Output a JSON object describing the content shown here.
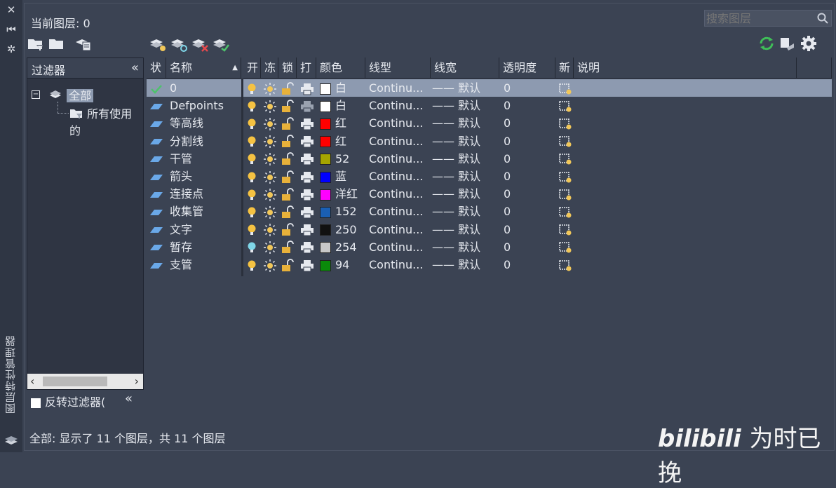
{
  "palette": {
    "list_bg": "#3b4353",
    "selection": "#8d9ab0",
    "bulb_on": "#f5c242",
    "bulb_off": "#7fd6e8",
    "sun": "#f1c75a",
    "lock": "#e8b13a",
    "check": "#4ec26c",
    "layer_icon": "#6aa8e8",
    "refresh": "#3fbf58"
  },
  "panel": {
    "current_layer": "当前图层: 0",
    "search_placeholder": "搜索图层",
    "status": "全部: 显示了 11 个图层，共 11 个图层",
    "vertical_title": "图层特性管理器"
  },
  "filters": {
    "header": "过滤器",
    "tree_all": "全部",
    "tree_used": "所有使用的",
    "invert_label": "反转过滤器("
  },
  "columns": {
    "status": "状",
    "name": "名称",
    "on": "开",
    "freeze": "冻",
    "lock": "锁",
    "plot": "打",
    "color": "颜色",
    "linetype": "线型",
    "lineweight": "线宽",
    "transparency": "透明度",
    "new_vp": "新",
    "description": "说明"
  },
  "layers": [
    {
      "name": "0",
      "current": true,
      "on": true,
      "plot": true,
      "color_hex": "#ffffff",
      "color": "白",
      "linetype": "Continu...",
      "lineweight": "—— 默认",
      "transparency": "0"
    },
    {
      "name": "Defpoints",
      "current": false,
      "on": true,
      "plot": false,
      "color_hex": "#ffffff",
      "color": "白",
      "linetype": "Continu...",
      "lineweight": "—— 默认",
      "transparency": "0"
    },
    {
      "name": "等高线",
      "current": false,
      "on": true,
      "plot": true,
      "color_hex": "#ff0000",
      "color": "红",
      "linetype": "Continu...",
      "lineweight": "—— 默认",
      "transparency": "0"
    },
    {
      "name": "分割线",
      "current": false,
      "on": true,
      "plot": true,
      "color_hex": "#ff0000",
      "color": "红",
      "linetype": "Continu...",
      "lineweight": "—— 默认",
      "transparency": "0"
    },
    {
      "name": "干管",
      "current": false,
      "on": true,
      "plot": true,
      "color_hex": "#a5a500",
      "color": "52",
      "linetype": "Continu...",
      "lineweight": "—— 默认",
      "transparency": "0"
    },
    {
      "name": "箭头",
      "current": false,
      "on": true,
      "plot": true,
      "color_hex": "#0000ff",
      "color": "蓝",
      "linetype": "Continu...",
      "lineweight": "—— 默认",
      "transparency": "0"
    },
    {
      "name": "连接点",
      "current": false,
      "on": true,
      "plot": true,
      "color_hex": "#ff00ff",
      "color": "洋红",
      "linetype": "Continu...",
      "lineweight": "—— 默认",
      "transparency": "0"
    },
    {
      "name": "收集管",
      "current": false,
      "on": true,
      "plot": true,
      "color_hex": "#1a5fb4",
      "color": "152",
      "linetype": "Continu...",
      "lineweight": "—— 默认",
      "transparency": "0"
    },
    {
      "name": "文字",
      "current": false,
      "on": true,
      "plot": true,
      "color_hex": "#111111",
      "color": "250",
      "linetype": "Continu...",
      "lineweight": "—— 默认",
      "transparency": "0"
    },
    {
      "name": "暂存",
      "current": false,
      "on": false,
      "plot": true,
      "color_hex": "#c8c8c8",
      "color": "254",
      "linetype": "Continu...",
      "lineweight": "—— 默认",
      "transparency": "0"
    },
    {
      "name": "支管",
      "current": false,
      "on": true,
      "plot": true,
      "color_hex": "#0a8a0a",
      "color": "94",
      "linetype": "Continu...",
      "lineweight": "—— 默认",
      "transparency": "0"
    }
  ],
  "watermark": {
    "brand": "bilibili",
    "handle": "为时已挽"
  }
}
